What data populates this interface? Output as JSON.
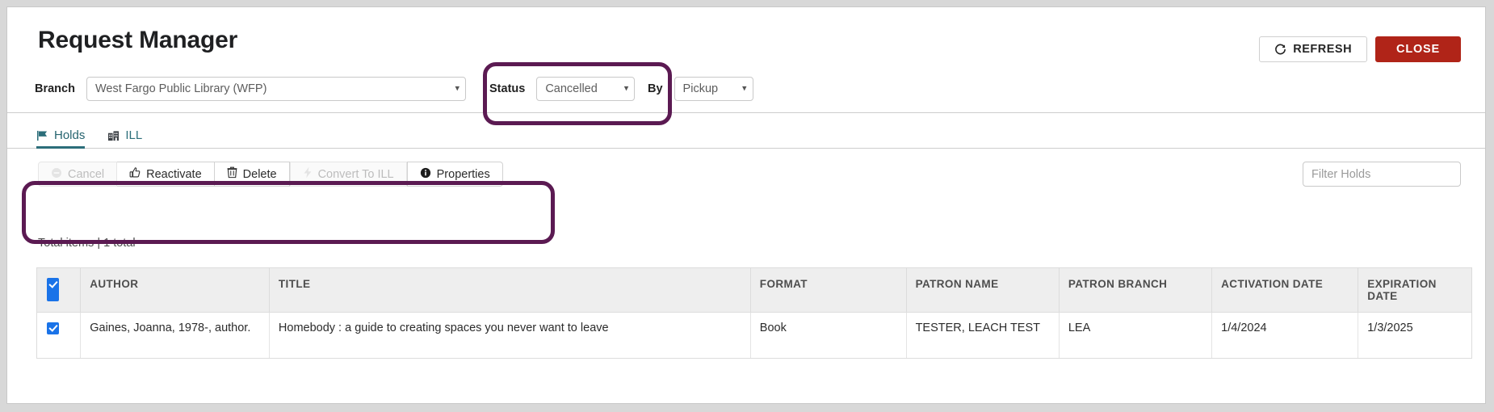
{
  "header": {
    "title": "Request Manager",
    "refresh_label": "REFRESH",
    "close_label": "CLOSE",
    "refresh_icon": "refresh-icon",
    "accent_close_color": "#b02418"
  },
  "filters": {
    "branch_label": "Branch",
    "branch_value": "West Fargo Public Library (WFP)",
    "status_label": "Status",
    "status_value": "Cancelled",
    "by_label": "By",
    "by_value": "Pickup"
  },
  "tabs": [
    {
      "label": "Holds",
      "icon": "flag-icon",
      "active": true
    },
    {
      "label": "ILL",
      "icon": "library-building-icon",
      "active": false
    }
  ],
  "toolbar": {
    "buttons": [
      {
        "label": "Cancel",
        "icon": "cancel-circle-icon",
        "disabled": true
      },
      {
        "label": "Reactivate",
        "icon": "thumbs-up-icon",
        "disabled": false
      },
      {
        "label": "Delete",
        "icon": "trash-icon",
        "disabled": false
      },
      {
        "label": "Convert To ILL",
        "icon": "lightning-bolt-icon",
        "disabled": true
      },
      {
        "label": "Properties",
        "icon": "info-circle-icon",
        "disabled": false
      }
    ],
    "filter_placeholder": "Filter Holds",
    "filter_value": ""
  },
  "summary": {
    "total_items": "Total items | 1 total"
  },
  "table": {
    "columns": [
      "AUTHOR",
      "TITLE",
      "FORMAT",
      "PATRON NAME",
      "PATRON BRANCH",
      "ACTIVATION DATE",
      "EXPIRATION DATE"
    ],
    "header_checkbox_checked": true,
    "rows": [
      {
        "checked": true,
        "author": "Gaines, Joanna, 1978-, author.",
        "title": "Homebody : a guide to creating spaces you never want to leave",
        "format": "Book",
        "patron_name": "TESTER, LEACH TEST",
        "patron_branch": "LEA",
        "activation_date": "1/4/2024",
        "expiration_date": "1/3/2025"
      }
    ]
  },
  "annotations": {
    "highlight_color": "#5b1a52",
    "regions": [
      "status-filter-group",
      "action-button-toolbar"
    ]
  }
}
